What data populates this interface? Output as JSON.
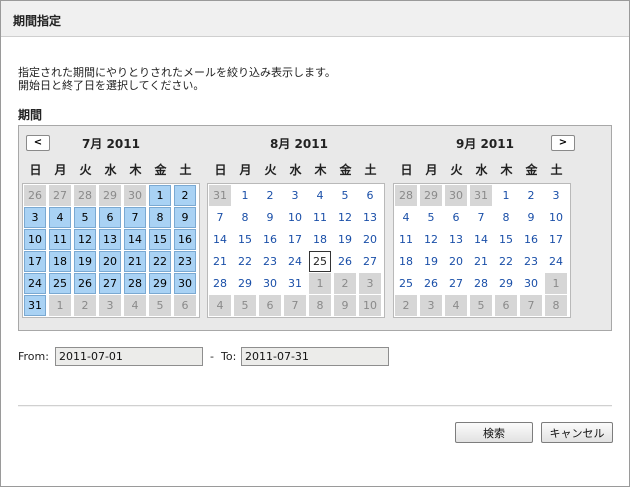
{
  "dialog": {
    "title": "期間指定",
    "description_line1": "指定された期間にやりとりされたメールを絞り込み表示します。",
    "description_line2": "開始日と終了日を選択してください。",
    "period_label": "期間"
  },
  "calendar": {
    "prev_label": "<",
    "next_label": ">",
    "weekdays": [
      "日",
      "月",
      "火",
      "水",
      "木",
      "金",
      "土"
    ],
    "months": [
      {
        "title": "7月 2011",
        "days": [
          [
            "26",
            "oth"
          ],
          [
            "27",
            "oth"
          ],
          [
            "28",
            "oth"
          ],
          [
            "29",
            "oth"
          ],
          [
            "30",
            "oth"
          ],
          [
            "1",
            "sel"
          ],
          [
            "2",
            "sel"
          ],
          [
            "3",
            "sel"
          ],
          [
            "4",
            "sel"
          ],
          [
            "5",
            "sel"
          ],
          [
            "6",
            "sel"
          ],
          [
            "7",
            "sel"
          ],
          [
            "8",
            "sel"
          ],
          [
            "9",
            "sel"
          ],
          [
            "10",
            "sel"
          ],
          [
            "11",
            "sel"
          ],
          [
            "12",
            "sel"
          ],
          [
            "13",
            "sel"
          ],
          [
            "14",
            "sel"
          ],
          [
            "15",
            "sel"
          ],
          [
            "16",
            "sel"
          ],
          [
            "17",
            "sel"
          ],
          [
            "18",
            "sel"
          ],
          [
            "19",
            "sel"
          ],
          [
            "20",
            "sel"
          ],
          [
            "21",
            "sel"
          ],
          [
            "22",
            "sel"
          ],
          [
            "23",
            "sel"
          ],
          [
            "24",
            "sel"
          ],
          [
            "25",
            "sel"
          ],
          [
            "26",
            "sel"
          ],
          [
            "27",
            "sel"
          ],
          [
            "28",
            "sel"
          ],
          [
            "29",
            "sel"
          ],
          [
            "30",
            "sel"
          ],
          [
            "31",
            "sel"
          ],
          [
            "1",
            "oth"
          ],
          [
            "2",
            "oth"
          ],
          [
            "3",
            "oth"
          ],
          [
            "4",
            "oth"
          ],
          [
            "5",
            "oth"
          ],
          [
            "6",
            "oth"
          ]
        ]
      },
      {
        "title": "8月 2011",
        "days": [
          [
            "31",
            "oth"
          ],
          [
            "1",
            "cur"
          ],
          [
            "2",
            "cur"
          ],
          [
            "3",
            "cur"
          ],
          [
            "4",
            "cur"
          ],
          [
            "5",
            "cur"
          ],
          [
            "6",
            "cur"
          ],
          [
            "7",
            "cur"
          ],
          [
            "8",
            "cur"
          ],
          [
            "9",
            "cur"
          ],
          [
            "10",
            "cur"
          ],
          [
            "11",
            "cur"
          ],
          [
            "12",
            "cur"
          ],
          [
            "13",
            "cur"
          ],
          [
            "14",
            "cur"
          ],
          [
            "15",
            "cur"
          ],
          [
            "16",
            "cur"
          ],
          [
            "17",
            "cur"
          ],
          [
            "18",
            "cur"
          ],
          [
            "19",
            "cur"
          ],
          [
            "20",
            "cur"
          ],
          [
            "21",
            "cur"
          ],
          [
            "22",
            "cur"
          ],
          [
            "23",
            "cur"
          ],
          [
            "24",
            "cur"
          ],
          [
            "25",
            "today"
          ],
          [
            "26",
            "cur"
          ],
          [
            "27",
            "cur"
          ],
          [
            "28",
            "cur"
          ],
          [
            "29",
            "cur"
          ],
          [
            "30",
            "cur"
          ],
          [
            "31",
            "cur"
          ],
          [
            "1",
            "oth"
          ],
          [
            "2",
            "oth"
          ],
          [
            "3",
            "oth"
          ],
          [
            "4",
            "oth"
          ],
          [
            "5",
            "oth"
          ],
          [
            "6",
            "oth"
          ],
          [
            "7",
            "oth"
          ],
          [
            "8",
            "oth"
          ],
          [
            "9",
            "oth"
          ],
          [
            "10",
            "oth"
          ]
        ]
      },
      {
        "title": "9月 2011",
        "days": [
          [
            "28",
            "oth"
          ],
          [
            "29",
            "oth"
          ],
          [
            "30",
            "oth"
          ],
          [
            "31",
            "oth"
          ],
          [
            "1",
            "cur"
          ],
          [
            "2",
            "cur"
          ],
          [
            "3",
            "cur"
          ],
          [
            "4",
            "cur"
          ],
          [
            "5",
            "cur"
          ],
          [
            "6",
            "cur"
          ],
          [
            "7",
            "cur"
          ],
          [
            "8",
            "cur"
          ],
          [
            "9",
            "cur"
          ],
          [
            "10",
            "cur"
          ],
          [
            "11",
            "cur"
          ],
          [
            "12",
            "cur"
          ],
          [
            "13",
            "cur"
          ],
          [
            "14",
            "cur"
          ],
          [
            "15",
            "cur"
          ],
          [
            "16",
            "cur"
          ],
          [
            "17",
            "cur"
          ],
          [
            "18",
            "cur"
          ],
          [
            "19",
            "cur"
          ],
          [
            "20",
            "cur"
          ],
          [
            "21",
            "cur"
          ],
          [
            "22",
            "cur"
          ],
          [
            "23",
            "cur"
          ],
          [
            "24",
            "cur"
          ],
          [
            "25",
            "cur"
          ],
          [
            "26",
            "cur"
          ],
          [
            "27",
            "cur"
          ],
          [
            "28",
            "cur"
          ],
          [
            "29",
            "cur"
          ],
          [
            "30",
            "cur"
          ],
          [
            "1",
            "oth"
          ],
          [
            "2",
            "oth"
          ],
          [
            "3",
            "oth"
          ],
          [
            "4",
            "oth"
          ],
          [
            "5",
            "oth"
          ],
          [
            "6",
            "oth"
          ],
          [
            "7",
            "oth"
          ],
          [
            "8",
            "oth"
          ]
        ]
      }
    ]
  },
  "range": {
    "from_label": "From:",
    "from_value": "2011-07-01",
    "separator": "-",
    "to_label": "To:",
    "to_value": "2011-07-31"
  },
  "buttons": {
    "search_label": "検索",
    "cancel_label": "キャンセル"
  }
}
